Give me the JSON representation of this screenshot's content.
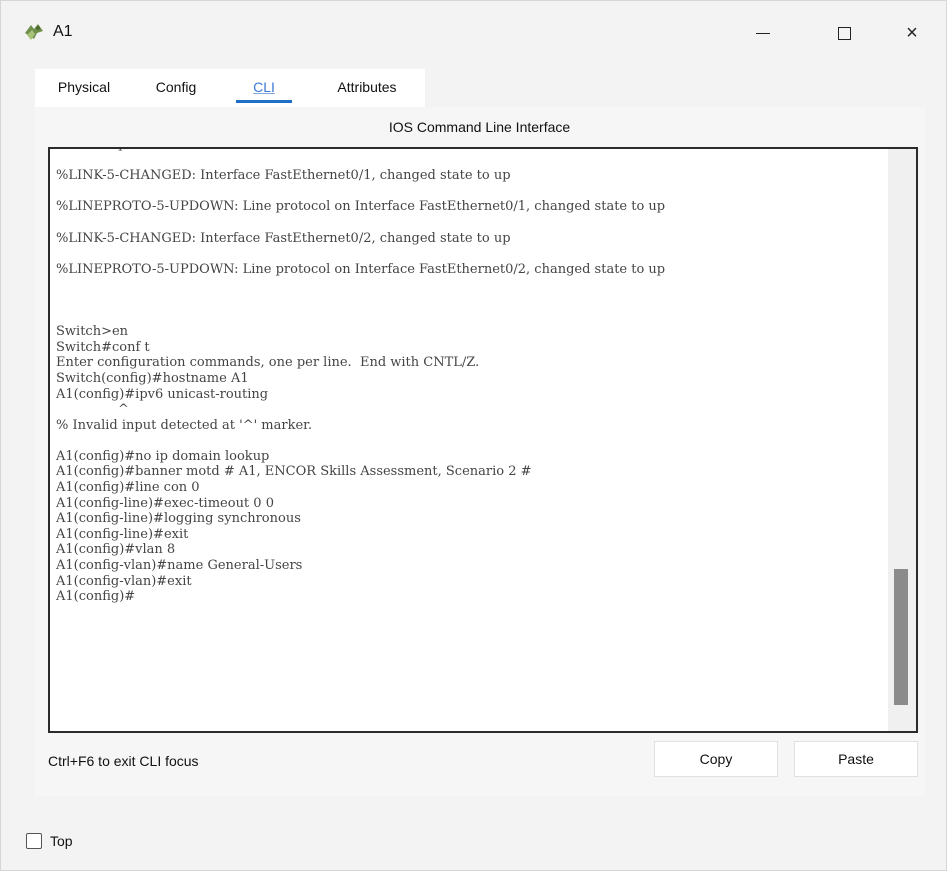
{
  "window": {
    "title": "A1",
    "icon": "router-device-icon",
    "controls": {
      "minimize": "minimize-icon",
      "maximize": "maximize-icon",
      "close": "×"
    }
  },
  "tabs": [
    {
      "label": "Physical"
    },
    {
      "label": "Config"
    },
    {
      "label": "CLI"
    },
    {
      "label": "Attributes"
    }
  ],
  "active_tab": "CLI",
  "cli": {
    "heading": "IOS Command Line Interface",
    "lines": [
      "state to up",
      "",
      "%LINK-5-CHANGED: Interface FastEthernet0/1, changed state to up",
      "",
      "%LINEPROTO-5-UPDOWN: Line protocol on Interface FastEthernet0/1, changed state to up",
      "",
      "%LINK-5-CHANGED: Interface FastEthernet0/2, changed state to up",
      "",
      "%LINEPROTO-5-UPDOWN: Line protocol on Interface FastEthernet0/2, changed state to up",
      "",
      "",
      "",
      "Switch>en",
      "Switch#conf t",
      "Enter configuration commands, one per line.  End with CNTL/Z.",
      "Switch(config)#hostname A1",
      "A1(config)#ipv6 unicast-routing",
      "               ^",
      "% Invalid input detected at '^' marker.",
      "",
      "A1(config)#no ip domain lookup",
      "A1(config)#banner motd # A1, ENCOR Skills Assessment, Scenario 2 #",
      "A1(config)#line con 0",
      "A1(config-line)#exec-timeout 0 0",
      "A1(config-line)#logging synchronous",
      "A1(config-line)#exit",
      "A1(config)#vlan 8",
      "A1(config-vlan)#name General-Users",
      "A1(config-vlan)#exit",
      "A1(config)#"
    ],
    "focus_hint": "Ctrl+F6 to exit CLI focus",
    "copy_label": "Copy",
    "paste_label": "Paste"
  },
  "top_checkbox": {
    "label": "Top",
    "checked": false
  }
}
